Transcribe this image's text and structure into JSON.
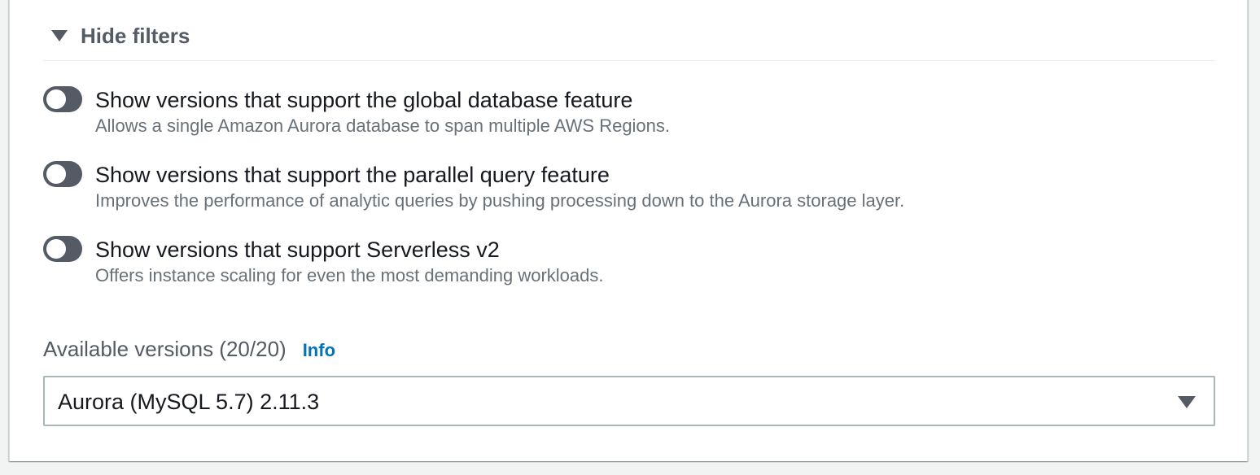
{
  "filters": {
    "toggle_label": "Hide filters",
    "options": [
      {
        "label": "Show versions that support the global database feature",
        "description": "Allows a single Amazon Aurora database to span multiple AWS Regions.",
        "enabled": false
      },
      {
        "label": "Show versions that support the parallel query feature",
        "description": "Improves the performance of analytic queries by pushing processing down to the Aurora storage layer.",
        "enabled": false
      },
      {
        "label": "Show versions that support Serverless v2",
        "description": "Offers instance scaling for even the most demanding workloads.",
        "enabled": false
      }
    ]
  },
  "versions": {
    "label": "Available versions (20/20)",
    "info_link": "Info",
    "selected": "Aurora (MySQL 5.7) 2.11.3"
  },
  "colors": {
    "toggle_off": "#545b64",
    "link": "#0073bb",
    "secondary_text": "#687078"
  }
}
